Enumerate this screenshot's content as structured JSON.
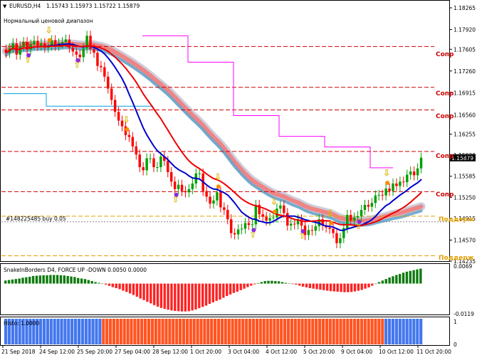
{
  "header": {
    "symbol": "EURUSD,H4",
    "ohlc": "1.15743 1.15973 1.15722 1.15879",
    "indicator_caption": "Нормальный ценовой диапазон",
    "dollar_tag": "($$$)"
  },
  "position_label": "#148225485 buy 0.05",
  "sr_labels": [
    "Сопр",
    "Сопр",
    "Сопр",
    "Сопр",
    "Сопр",
    "Поддерж",
    "Поддерж"
  ],
  "sub1_title": "SnakeInBorders D4, FORCE UP -DOWN 0.0050 0.0000",
  "sub2_title": "Histo: 1.0000",
  "colors": {
    "bull_candle": "#00a000",
    "bear_candle": "#ff0000",
    "snake_blue": "#0000cc",
    "snake_red": "#ee0000",
    "band_pink": "#f08080",
    "band_gray": "#c8c8d8",
    "band_cyan": "#5aa0c8",
    "magenta": "#ff00ff",
    "cyan": "#00a0e0",
    "sr_red": "#d00000",
    "sup_orange": "#e0a000",
    "histo_blue": "#4477ee",
    "histo_red": "#ff5522"
  },
  "chart_data": [
    {
      "type": "candlestick",
      "symbol": "EURUSD",
      "timeframe": "H4",
      "price_axis": {
        "ticks": [
          "1.18265",
          "1.17920",
          "1.17605",
          "1.17260",
          "1.16915",
          "1.16560",
          "1.16255",
          "1.15920",
          "1.15585",
          "1.15250",
          "1.14915",
          "1.14570",
          "1.14235"
        ],
        "current_price": "1.15879"
      },
      "time_axis": [
        "21 Sep 2018",
        "24 Sep 12:00",
        "25 Sep 20:00",
        "27 Sep 04:00",
        "28 Sep 12:00",
        "1 Oct 20:00",
        "3 Oct 04:00",
        "4 Oct 12:00",
        "5 Oct 20:00",
        "9 Oct 04:00",
        "10 Oct 12:00",
        "11 Oct 20:00"
      ],
      "close": [
        1.1755,
        1.1762,
        1.177,
        1.1752,
        1.1765,
        1.1772,
        1.176,
        1.1768,
        1.1774,
        1.1766,
        1.177,
        1.1763,
        1.1766,
        1.1775,
        1.1766,
        1.177,
        1.1772,
        1.1776,
        1.1763,
        1.1757,
        1.1752,
        1.1748,
        1.1762,
        1.1782,
        1.1761,
        1.1755,
        1.1734,
        1.1732,
        1.1717,
        1.1698,
        1.168,
        1.1661,
        1.1647,
        1.1638,
        1.1624,
        1.1621,
        1.1606,
        1.1593,
        1.1573,
        1.1568,
        1.1587,
        1.1587,
        1.1573,
        1.1573,
        1.159,
        1.1583,
        1.1565,
        1.155,
        1.1538,
        1.1545,
        1.1535,
        1.1533,
        1.1538,
        1.1547,
        1.1563,
        1.1563,
        1.1535,
        1.1526,
        1.1515,
        1.152,
        1.1533,
        1.1509,
        1.1505,
        1.149,
        1.1468,
        1.1466,
        1.1474,
        1.1475,
        1.1484,
        1.1481,
        1.1482,
        1.1513,
        1.1498,
        1.1494,
        1.1488,
        1.1492,
        1.1493,
        1.1507,
        1.1512,
        1.15,
        1.148,
        1.1483,
        1.1482,
        1.149,
        1.148,
        1.1465,
        1.1473,
        1.1472,
        1.1479,
        1.149,
        1.148,
        1.1477,
        1.1475,
        1.1468,
        1.1452,
        1.146,
        1.1476,
        1.1497,
        1.1488,
        1.1493,
        1.1495,
        1.1505,
        1.1513,
        1.151,
        1.1516,
        1.1528,
        1.1529,
        1.1528,
        1.1539,
        1.1535,
        1.1547,
        1.1543,
        1.155,
        1.1549,
        1.1561,
        1.1566,
        1.156,
        1.1571,
        1.1588
      ]
    },
    {
      "type": "bar",
      "name": "SnakeInBorders D4, FORCE UP -DOWN 0.0050 0.0000",
      "y_ticks": [
        "0.0069",
        "-0.0119"
      ],
      "values": [
        0.0012,
        0.0014,
        0.0016,
        0.0018,
        0.002,
        0.0023,
        0.0025,
        0.0027,
        0.003,
        0.0031,
        0.0032,
        0.0033,
        0.0033,
        0.0034,
        0.0034,
        0.0034,
        0.0033,
        0.0032,
        0.003,
        0.0028,
        0.0026,
        0.0022,
        0.002,
        0.0018,
        0.0014,
        0.001,
        0.0006,
        0.0003,
        0.0,
        -0.0004,
        -0.0009,
        -0.0014,
        -0.0018,
        -0.0022,
        -0.0028,
        -0.0033,
        -0.0039,
        -0.0045,
        -0.0052,
        -0.0059,
        -0.0065,
        -0.0072,
        -0.0078,
        -0.0085,
        -0.0091,
        -0.0096,
        -0.01,
        -0.0103,
        -0.0106,
        -0.0108,
        -0.0109,
        -0.011,
        -0.011,
        -0.0109,
        -0.0106,
        -0.0102,
        -0.0097,
        -0.0092,
        -0.0087,
        -0.008,
        -0.0074,
        -0.0068,
        -0.0063,
        -0.0056,
        -0.0049,
        -0.0043,
        -0.0037,
        -0.0032,
        -0.0026,
        -0.002,
        -0.0014,
        -0.0008,
        -0.0003,
        0.0002,
        0.0006,
        0.001,
        0.0011,
        0.0011,
        0.001,
        0.0009,
        0.0006,
        0.0003,
        0.0,
        -0.0002,
        -0.0004,
        -0.0008,
        -0.0012,
        -0.0015,
        -0.0018,
        -0.002,
        -0.0022,
        -0.0024,
        -0.0026,
        -0.0028,
        -0.003,
        -0.0031,
        -0.0032,
        -0.0033,
        -0.0034,
        -0.0034,
        -0.0033,
        -0.0031,
        -0.0028,
        -0.0025,
        -0.002,
        -0.0015,
        -0.0008,
        0.0,
        0.0006,
        0.0012,
        0.0018,
        0.0024,
        0.0029,
        0.0034,
        0.0038,
        0.0043,
        0.0047,
        0.005,
        0.0053,
        0.0056,
        0.0059
      ]
    },
    {
      "type": "bar",
      "name": "Histo: 1.0000",
      "y_ticks": [
        "1",
        "0"
      ],
      "values": [
        1,
        1,
        1,
        1,
        1,
        1,
        1,
        1,
        1,
        1,
        1,
        1,
        1,
        1,
        1,
        1,
        1,
        1,
        1,
        1,
        1,
        1,
        1,
        1,
        1,
        1,
        1,
        1,
        -1,
        -1,
        -1,
        -1,
        -1,
        -1,
        -1,
        -1,
        -1,
        -1,
        -1,
        -1,
        -1,
        -1,
        -1,
        -1,
        -1,
        -1,
        -1,
        -1,
        -1,
        -1,
        -1,
        -1,
        -1,
        -1,
        -1,
        -1,
        -1,
        -1,
        -1,
        -1,
        -1,
        -1,
        -1,
        -1,
        -1,
        -1,
        -1,
        -1,
        -1,
        -1,
        -1,
        -1,
        -1,
        -1,
        -1,
        -1,
        -1,
        -1,
        -1,
        -1,
        -1,
        -1,
        -1,
        -1,
        -1,
        -1,
        -1,
        -1,
        -1,
        -1,
        -1,
        -1,
        -1,
        -1,
        -1,
        -1,
        -1,
        -1,
        -1,
        -1,
        -1,
        -1,
        -1,
        -1,
        -1,
        -1,
        -1,
        -1,
        -1,
        1,
        1,
        1,
        1,
        1,
        1,
        1,
        1,
        1,
        1,
        1
      ]
    }
  ]
}
